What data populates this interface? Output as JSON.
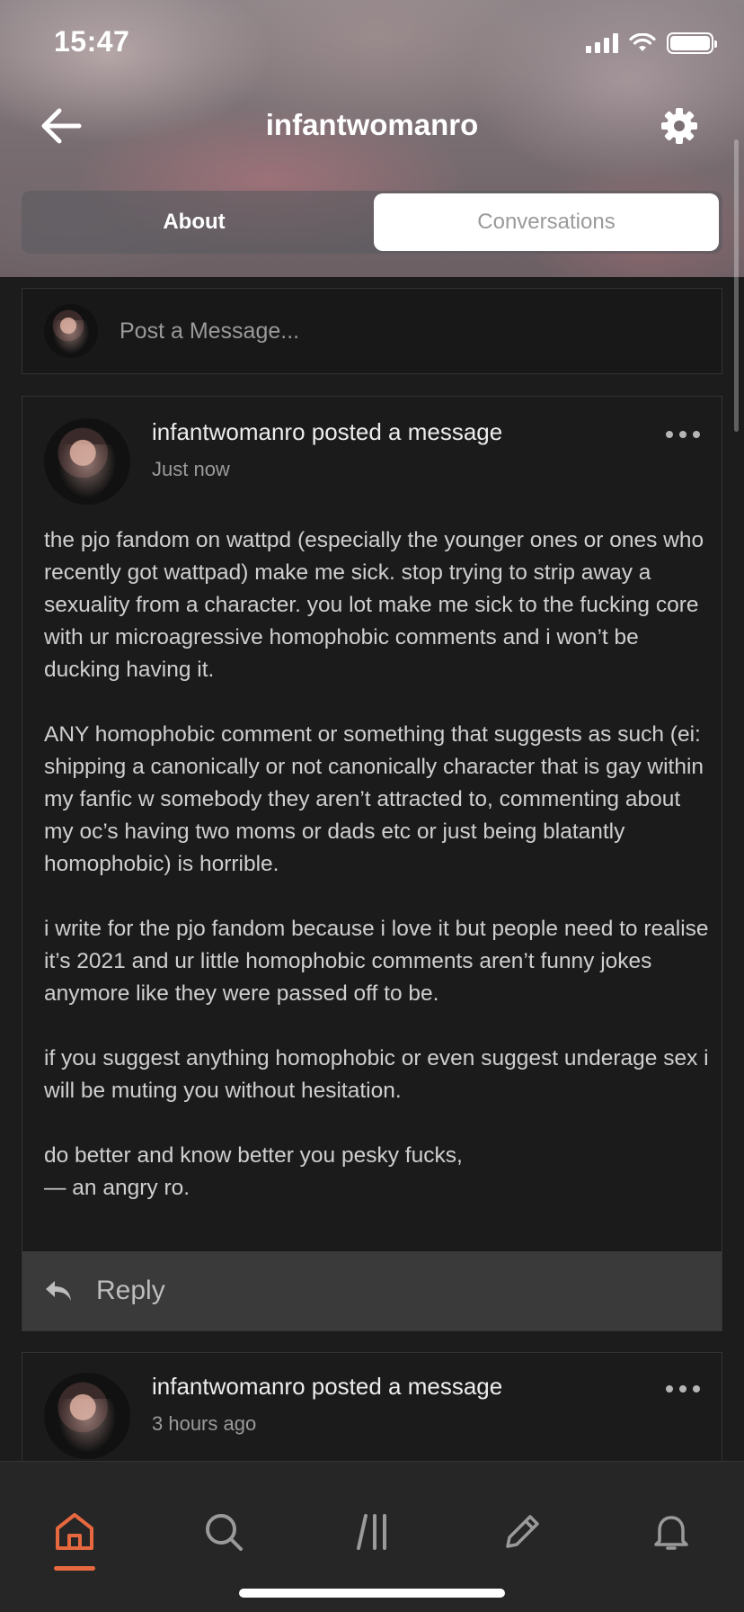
{
  "status_bar": {
    "time": "15:47"
  },
  "header": {
    "title": "infantwomanro",
    "back_icon": "arrow-left-icon",
    "settings_icon": "gear-icon",
    "tabs": [
      {
        "label": "About",
        "selected": false
      },
      {
        "label": "Conversations",
        "selected": true
      }
    ]
  },
  "compose": {
    "placeholder": "Post a Message..."
  },
  "messages": [
    {
      "author_line": "infantwomanro posted a message",
      "time": "Just now",
      "paragraphs": [
        "the pjo fandom on wattpd (especially the younger ones or ones who recently got wattpad) make me sick. stop trying to strip away a sexuality from a character. you lot make me sick to the fucking core with ur microagressive homophobic comments and i won’t be ducking having it.",
        "ANY homophobic comment or something that suggests as such (ei: shipping a canonically or not canonically character that is gay within my fanfic w somebody they aren’t attracted to, commenting about my oc’s having two moms or dads etc or just being blatantly homophobic) is horrible.",
        "i write for the pjo fandom because i love it but people need to realise it’s 2021 and ur little homophobic comments aren’t funny jokes anymore like they were passed off to be.",
        "if you suggest anything homophobic or even suggest underage sex i will be muting you without hesitation.",
        "do better and know better you pesky fucks,\n— an angry ro."
      ],
      "reply_label": "Reply"
    },
    {
      "author_line": "infantwomanro posted a message",
      "time": "3 hours ago"
    }
  ],
  "tabbar": {
    "items": [
      {
        "icon": "home-icon",
        "active": true
      },
      {
        "icon": "search-icon",
        "active": false
      },
      {
        "icon": "library-icon",
        "active": false
      },
      {
        "icon": "pencil-icon",
        "active": false
      },
      {
        "icon": "bell-icon",
        "active": false
      }
    ],
    "active_color": "#e7683f"
  }
}
